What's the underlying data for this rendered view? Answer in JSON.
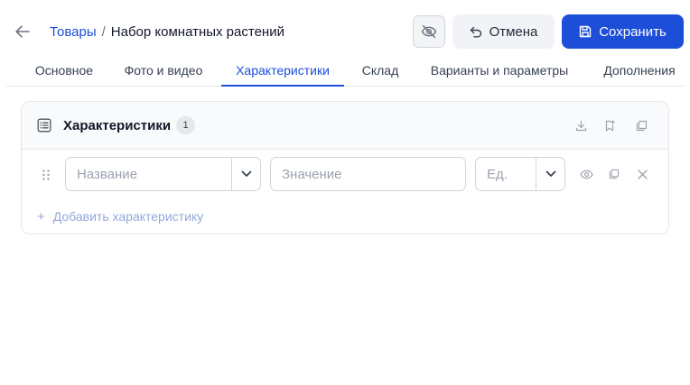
{
  "header": {
    "back_icon": "arrow-left-icon",
    "breadcrumb": {
      "parent": "Товары",
      "separator": "/",
      "current": "Набор комнатных растений"
    },
    "hide_icon": "eye-off-icon",
    "cancel_icon": "undo-icon",
    "cancel_label": "Отмена",
    "save_icon": "floppy-disk-icon",
    "save_label": "Сохранить"
  },
  "tabs": [
    {
      "label": "Основное",
      "active": false
    },
    {
      "label": "Фото и видео",
      "active": false
    },
    {
      "label": "Характеристики",
      "active": true
    },
    {
      "label": "Склад",
      "active": false
    },
    {
      "label": "Варианты и параметры",
      "active": false
    },
    {
      "label": "Дополнения",
      "active": false
    }
  ],
  "card": {
    "title": "Характеристики",
    "count": "1",
    "head_icons": [
      "list-icon",
      "download-icon",
      "bookmark-add-icon",
      "copy-icon"
    ],
    "row": {
      "name_placeholder": "Название",
      "value_placeholder": "Значение",
      "unit_placeholder": "Ед.",
      "icons": [
        "drag-handle-icon",
        "chevron-down-icon",
        "eye-icon",
        "copy-icon",
        "close-icon"
      ]
    },
    "add_label": "Добавить характеристику"
  },
  "colors": {
    "accent": "#1d4ed8",
    "border": "#e5e7eb",
    "muted_text": "#9ca3af",
    "add_link": "#93a8d9"
  }
}
